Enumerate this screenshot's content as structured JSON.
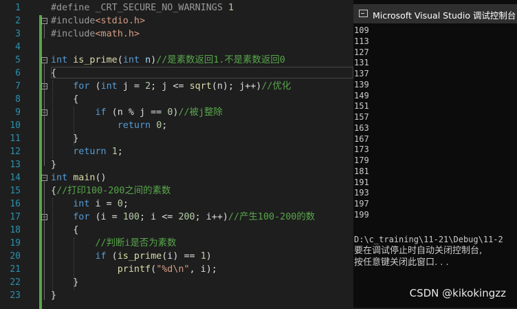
{
  "editor": {
    "line_numbers": [
      "1",
      "2",
      "3",
      "4",
      "5",
      "6",
      "7",
      "8",
      "9",
      "10",
      "11",
      "12",
      "13",
      "14",
      "15",
      "16",
      "17",
      "18",
      "19",
      "20",
      "21",
      "22",
      "23"
    ],
    "lines": [
      [
        {
          "t": "#define ",
          "c": "pp"
        },
        {
          "t": "_CRT_SECURE_NO_WARNINGS ",
          "c": "pp"
        },
        {
          "t": "1",
          "c": "num"
        }
      ],
      [
        {
          "t": "#include",
          "c": "pp"
        },
        {
          "t": "<stdio.h>",
          "c": "str"
        }
      ],
      [
        {
          "t": "#include",
          "c": "pp"
        },
        {
          "t": "<math.h>",
          "c": "str"
        }
      ],
      [],
      [
        {
          "t": "int",
          "c": "kw"
        },
        {
          "t": " "
        },
        {
          "t": "is_prime",
          "c": "fn"
        },
        {
          "t": "("
        },
        {
          "t": "int",
          "c": "kw"
        },
        {
          "t": " "
        },
        {
          "t": "n",
          "c": "var"
        },
        {
          "t": ")"
        },
        {
          "t": "//是素数返回1.不是素数返回0",
          "c": "cm"
        }
      ],
      [
        {
          "t": "{"
        }
      ],
      [
        {
          "t": "    "
        },
        {
          "t": "for",
          "c": "kw"
        },
        {
          "t": " ("
        },
        {
          "t": "int",
          "c": "kw"
        },
        {
          "t": " j = "
        },
        {
          "t": "2",
          "c": "num"
        },
        {
          "t": "; j <= "
        },
        {
          "t": "sqrt",
          "c": "fn"
        },
        {
          "t": "(n); j++)"
        },
        {
          "t": "//优化",
          "c": "cm"
        }
      ],
      [
        {
          "t": "    {"
        }
      ],
      [
        {
          "t": "        "
        },
        {
          "t": "if",
          "c": "kw"
        },
        {
          "t": " (n % j == "
        },
        {
          "t": "0",
          "c": "num"
        },
        {
          "t": ")"
        },
        {
          "t": "//被j整除",
          "c": "cm"
        }
      ],
      [
        {
          "t": "            "
        },
        {
          "t": "return",
          "c": "kw"
        },
        {
          "t": " "
        },
        {
          "t": "0",
          "c": "num"
        },
        {
          "t": ";"
        }
      ],
      [
        {
          "t": "    }"
        }
      ],
      [
        {
          "t": "    "
        },
        {
          "t": "return",
          "c": "kw"
        },
        {
          "t": " "
        },
        {
          "t": "1",
          "c": "num"
        },
        {
          "t": ";"
        }
      ],
      [
        {
          "t": "}"
        }
      ],
      [
        {
          "t": "int",
          "c": "kw"
        },
        {
          "t": " "
        },
        {
          "t": "main",
          "c": "fn"
        },
        {
          "t": "()"
        }
      ],
      [
        {
          "t": "{"
        },
        {
          "t": "//打印100-200之间的素数",
          "c": "cm"
        }
      ],
      [
        {
          "t": "    "
        },
        {
          "t": "int",
          "c": "kw"
        },
        {
          "t": " i = "
        },
        {
          "t": "0",
          "c": "num"
        },
        {
          "t": ";"
        }
      ],
      [
        {
          "t": "    "
        },
        {
          "t": "for",
          "c": "kw"
        },
        {
          "t": " (i = "
        },
        {
          "t": "100",
          "c": "num"
        },
        {
          "t": "; i <= "
        },
        {
          "t": "200",
          "c": "num"
        },
        {
          "t": "; i++)"
        },
        {
          "t": "//产生100-200的数",
          "c": "cm"
        }
      ],
      [
        {
          "t": "    {"
        }
      ],
      [
        {
          "t": "        "
        },
        {
          "t": "//判断i是否为素数",
          "c": "cm"
        }
      ],
      [
        {
          "t": "        "
        },
        {
          "t": "if",
          "c": "kw"
        },
        {
          "t": " ("
        },
        {
          "t": "is_prime",
          "c": "fn"
        },
        {
          "t": "(i) == "
        },
        {
          "t": "1",
          "c": "num"
        },
        {
          "t": ")"
        }
      ],
      [
        {
          "t": "            "
        },
        {
          "t": "printf",
          "c": "fn"
        },
        {
          "t": "("
        },
        {
          "t": "\"%d\\n\"",
          "c": "str"
        },
        {
          "t": ", i);"
        }
      ],
      [
        {
          "t": "    }"
        }
      ],
      [
        {
          "t": "}"
        }
      ]
    ]
  },
  "console": {
    "title": "Microsoft Visual Studio 调试控制台",
    "output": [
      "109",
      "113",
      "127",
      "131",
      "137",
      "139",
      "149",
      "151",
      "157",
      "163",
      "167",
      "173",
      "179",
      "181",
      "191",
      "193",
      "197",
      "199"
    ],
    "path_line": "D:\\c_training\\11-21\\Debug\\11-2",
    "message_1": "要在调试停止时自动关闭控制台,",
    "message_2": "按任意键关闭此窗口. . ."
  },
  "watermark": "CSDN @kikokingzz"
}
